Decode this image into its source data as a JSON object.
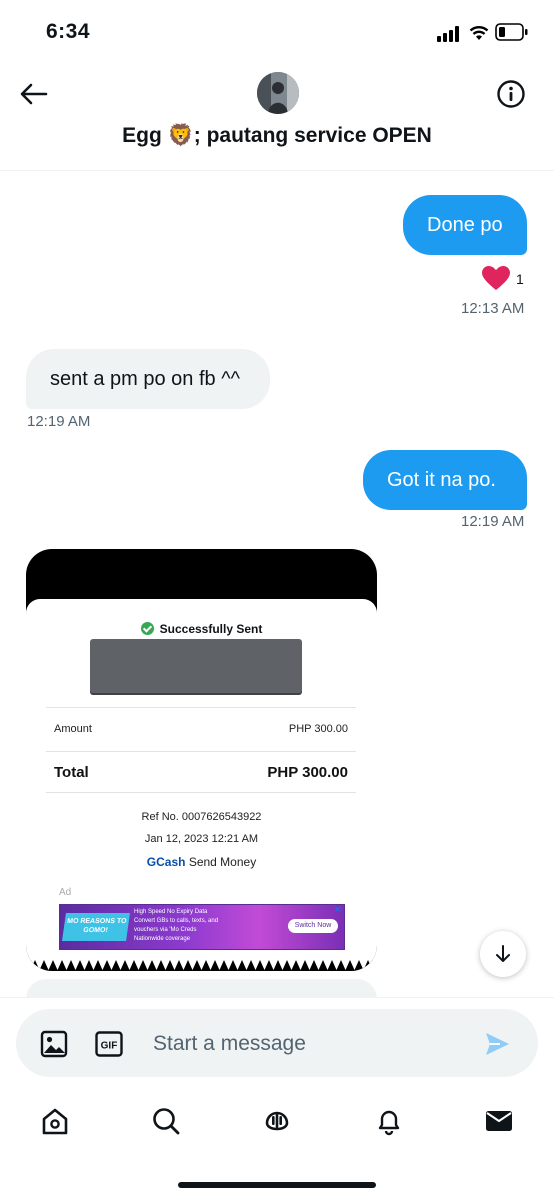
{
  "status_bar": {
    "time": "6:34"
  },
  "header": {
    "title": "Egg 🦁; pautang service OPEN"
  },
  "messages": [
    {
      "side": "sent",
      "text": "Done po",
      "time": "12:13 AM",
      "reaction": {
        "icon": "heart-icon",
        "count": "1"
      }
    },
    {
      "side": "received",
      "text": "sent a pm po on fb ^^",
      "time": "12:19 AM"
    },
    {
      "side": "sent",
      "text": "Got it na po.",
      "time": "12:19 AM"
    }
  ],
  "receipt": {
    "status": "Successfully Sent",
    "amount_label": "Amount",
    "amount_value": "PHP 300.00",
    "total_label": "Total",
    "total_value": "PHP 300.00",
    "ref_no": "Ref No. 0007626543922",
    "date": "Jan 12, 2023 12:21 AM",
    "brand": "GCash",
    "service": "Send Money",
    "ad_label": "Ad",
    "ad": {
      "headline": "MO REASONS TO GOMO!",
      "points": [
        "High Speed No Expiry Data",
        "Convert GBs to calls, texts, and vouchers via 'Mo Creds",
        "Nationwide coverage"
      ],
      "cta": "Switch Now",
      "close": "✕"
    }
  },
  "composer": {
    "placeholder": "Start a message"
  },
  "tab_bar": [
    "home-icon",
    "search-icon",
    "spaces-icon",
    "notifications-icon",
    "messages-icon"
  ],
  "colors": {
    "accent": "#1d9bf0",
    "bubble_received": "#eff3f4",
    "heart": "#e0245e",
    "text_secondary": "#536471"
  }
}
